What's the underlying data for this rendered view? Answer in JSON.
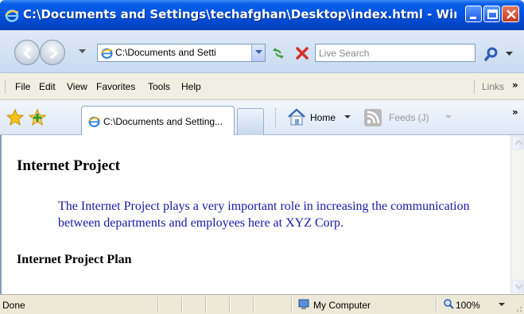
{
  "window": {
    "title": "C:\\Documents and Settings\\techafghan\\Desktop\\index.html - Windows In...",
    "colors": {
      "titlebar": "#0054e3",
      "close": "#c4381b"
    }
  },
  "navigation": {
    "address": "C:\\Documents and Setti",
    "search_placeholder": "Live Search",
    "icons": [
      "back-icon",
      "forward-icon",
      "refresh-icon",
      "stop-icon",
      "search-icon"
    ]
  },
  "menu": {
    "items": [
      "File",
      "Edit",
      "View",
      "Favorites",
      "Tools",
      "Help"
    ],
    "links_label": "Links",
    "overflow": "»"
  },
  "tabs": {
    "active_tab": "C:\\Documents and Setting...",
    "home_label": "Home",
    "feeds_label": "Feeds (J)",
    "overflow": "»"
  },
  "page": {
    "heading": "Internet Project",
    "paragraph": "The Internet Project plays a very important role in increasing the communication between departments and employees here at XYZ Corp.",
    "subheading": "Internet Project Plan",
    "paragraph_color": "#1a18a8"
  },
  "status": {
    "text": "Done",
    "zone": "My Computer",
    "zoom": "100%"
  }
}
